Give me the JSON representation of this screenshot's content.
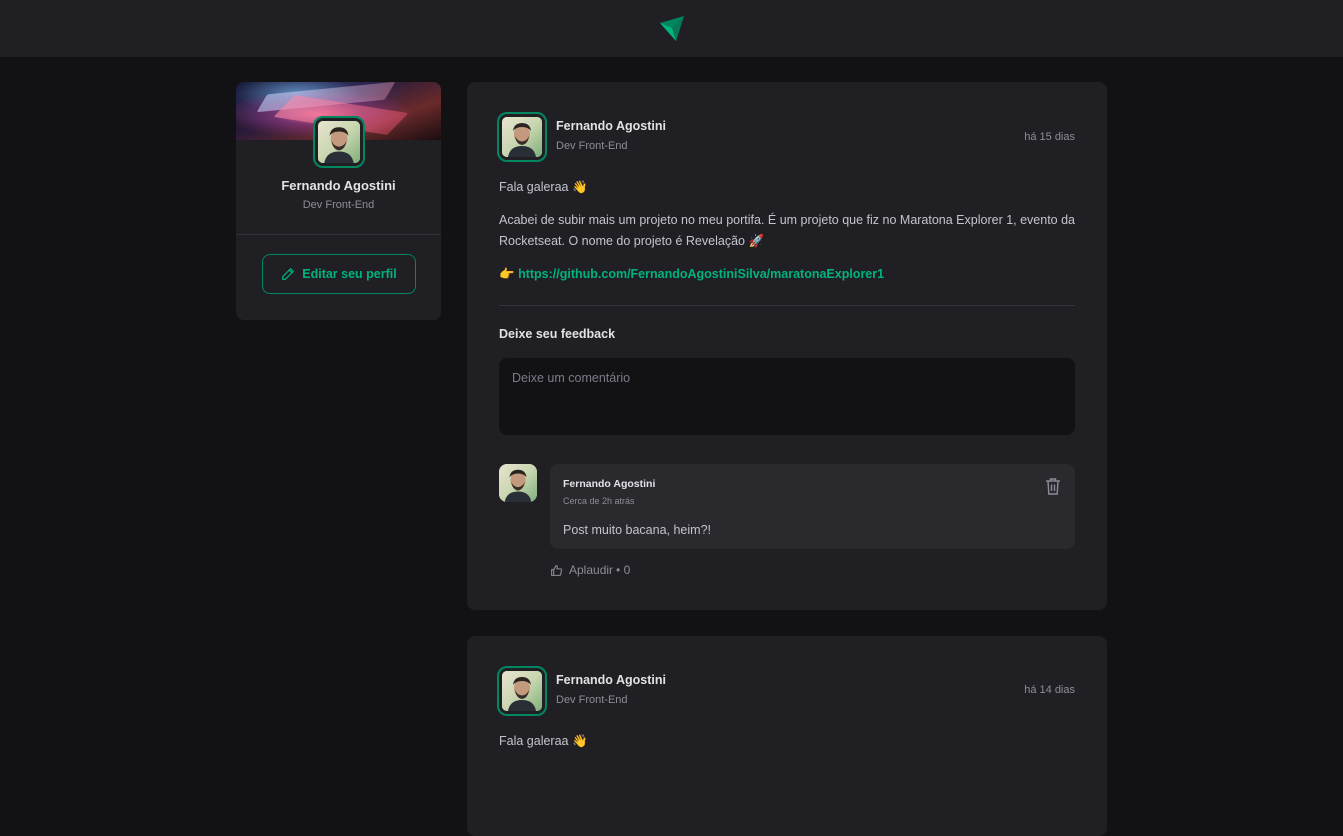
{
  "header": {
    "logo_icon": "ignite-feed-logo-icon"
  },
  "sidebar": {
    "name": "Fernando Agostini",
    "role": "Dev Front-End",
    "edit_button_label": "Editar seu perfil",
    "edit_icon": "pencil-icon"
  },
  "posts": [
    {
      "author": "Fernando Agostini",
      "role": "Dev Front-End",
      "time": "há 15 dias",
      "paragraphs": [
        "Fala galeraa 👋",
        "Acabei de subir mais um projeto no meu portifa. É um projeto que fiz no Maratona Explorer 1, evento da Rocketseat. O nome do projeto é Revelação 🚀"
      ],
      "link_prefix": "👉",
      "link": "https://github.com/FernandoAgostiniSilva/maratonaExplorer1",
      "feedback_title": "Deixe seu feedback",
      "comment_placeholder": "Deixe um comentário",
      "comments": [
        {
          "author": "Fernando Agostini",
          "time": "Cerca de 2h atrás",
          "text": "Post muito bacana, heim?!",
          "applaud_label": "Aplaudir",
          "applaud_count": "• 0"
        }
      ]
    },
    {
      "author": "Fernando Agostini",
      "role": "Dev Front-End",
      "time": "há 14 dias",
      "paragraphs": [
        "Fala galeraa 👋"
      ]
    }
  ],
  "colors": {
    "background": "#121214",
    "card": "#202024",
    "accent": "#00875f",
    "accent_light": "#00b37e"
  }
}
